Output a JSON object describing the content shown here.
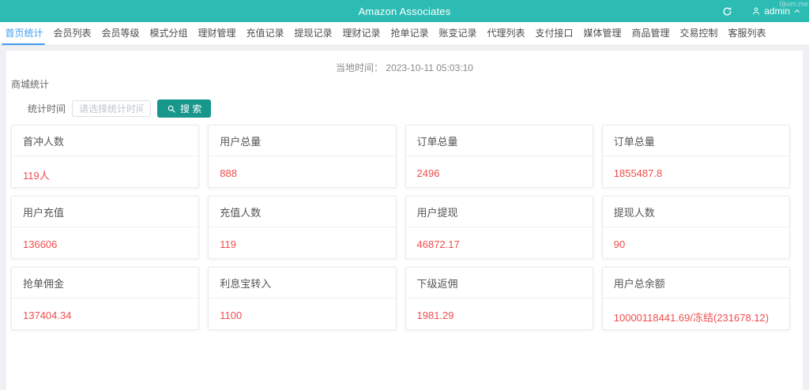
{
  "watermark": "0kvm.me",
  "colors": {
    "header_bg": "#2cbcb3",
    "button_teal": "#17968b",
    "active_tab": "#3d9ef5",
    "value_red": "#f14c4c",
    "page_bg": "#eef0f3"
  },
  "header": {
    "title": "Amazon Associates",
    "user_name": "admin",
    "icons": {
      "refresh": "circular-arrow",
      "user": "person-silhouette",
      "caret": "chevron-up"
    }
  },
  "nav": {
    "tabs": [
      {
        "label": "首页统计",
        "active": true
      },
      {
        "label": "会员列表",
        "active": false
      },
      {
        "label": "会员等级",
        "active": false
      },
      {
        "label": "模式分组",
        "active": false
      },
      {
        "label": "理财管理",
        "active": false
      },
      {
        "label": "充值记录",
        "active": false
      },
      {
        "label": "提现记录",
        "active": false
      },
      {
        "label": "理财记录",
        "active": false
      },
      {
        "label": "抢单记录",
        "active": false
      },
      {
        "label": "账变记录",
        "active": false
      },
      {
        "label": "代理列表",
        "active": false
      },
      {
        "label": "支付接口",
        "active": false
      },
      {
        "label": "媒体管理",
        "active": false
      },
      {
        "label": "商品管理",
        "active": false
      },
      {
        "label": "交易控制",
        "active": false
      },
      {
        "label": "客服列表",
        "active": false
      }
    ]
  },
  "content": {
    "local_time_label": "当地时间：",
    "local_time_value": "2023-10-11 05:03:10",
    "section_title": "商城统计",
    "filter": {
      "label": "统计时间",
      "placeholder": "请选择统计时间",
      "search_label": "搜 索",
      "search_icon": "magnifier"
    },
    "cards": [
      {
        "title": "首冲人数",
        "value": "119人"
      },
      {
        "title": "用户总量",
        "value": "888"
      },
      {
        "title": "订单总量",
        "value": "2496"
      },
      {
        "title": "订单总量",
        "value": "1855487.8"
      },
      {
        "title": "用户充值",
        "value": "136606"
      },
      {
        "title": "充值人数",
        "value": "119"
      },
      {
        "title": "用户提现",
        "value": "46872.17"
      },
      {
        "title": "提现人数",
        "value": "90"
      },
      {
        "title": "抢单佣金",
        "value": "137404.34"
      },
      {
        "title": "利息宝转入",
        "value": "1100"
      },
      {
        "title": "下级返佣",
        "value": "1981.29"
      },
      {
        "title": "用户总余额",
        "value": "10000118441.69/冻结(231678.12)"
      }
    ]
  }
}
